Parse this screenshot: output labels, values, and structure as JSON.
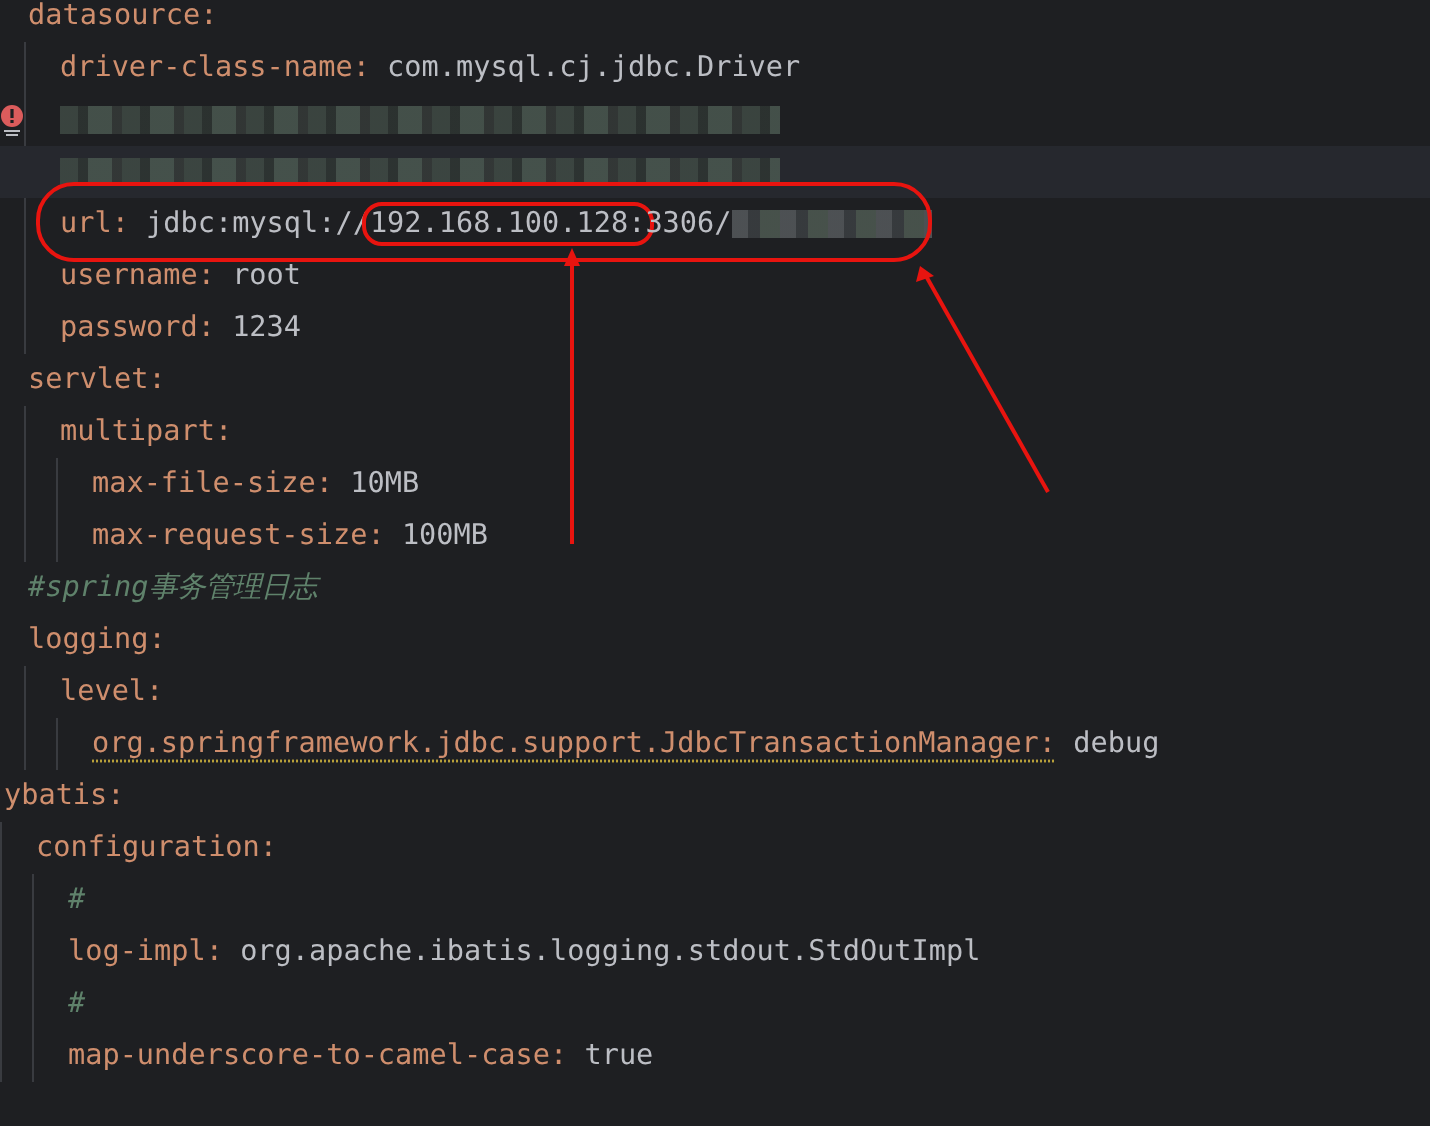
{
  "editor": {
    "tree": [
      {
        "children": [
          {
            "kind": "pair",
            "key": "datasource:",
            "children": [
              {
                "kind": "pair",
                "key": "driver-class-name:",
                "value": "com.mysql.cj.jdbc.Driver"
              },
              {
                "kind": "redacted",
                "warning": true,
                "highlighted": false
              },
              {
                "kind": "redacted",
                "warning": false,
                "highlighted": true
              },
              {
                "kind": "pair-redacted",
                "key": "url:",
                "value_parts": [
                  {
                    "text": "jdbc:mysql://",
                    "circled": false
                  },
                  {
                    "text": "192.168.100.128:",
                    "circled": true
                  },
                  {
                    "text": "3306/",
                    "circled": false
                  }
                ]
              },
              {
                "kind": "pair",
                "key": "username:",
                "value": "root"
              },
              {
                "kind": "pair",
                "key": "password:",
                "value": "1234"
              }
            ]
          },
          {
            "kind": "pair",
            "key": "servlet:",
            "children": [
              {
                "kind": "pair",
                "key": "multipart:",
                "children": [
                  {
                    "kind": "pair",
                    "key": "max-file-size:",
                    "value": "10MB"
                  },
                  {
                    "kind": "pair",
                    "key": "max-request-size:",
                    "value": "100MB"
                  }
                ]
              }
            ]
          },
          {
            "kind": "comment",
            "text": "#spring事务管理日志"
          },
          {
            "kind": "pair",
            "key": "logging:",
            "children": [
              {
                "kind": "pair",
                "key": "level:",
                "children": [
                  {
                    "kind": "pair",
                    "key": "org.springframework.jdbc.support.JdbcTransactionManager:",
                    "value": "debug",
                    "spellcheck_warning": true
                  }
                ]
              }
            ]
          }
        ]
      },
      {
        "kind": "pair",
        "key": "ybatis:",
        "children": [
          {
            "kind": "pair",
            "key": "configuration:",
            "children": [
              {
                "kind": "comment",
                "text": "#"
              },
              {
                "kind": "pair",
                "key": "log-impl:",
                "value": "org.apache.ibatis.logging.stdout.StdOutImpl"
              },
              {
                "kind": "comment",
                "text": "#"
              },
              {
                "kind": "pair",
                "key": "map-underscore-to-camel-case:",
                "value": "true"
              }
            ]
          }
        ]
      }
    ]
  }
}
